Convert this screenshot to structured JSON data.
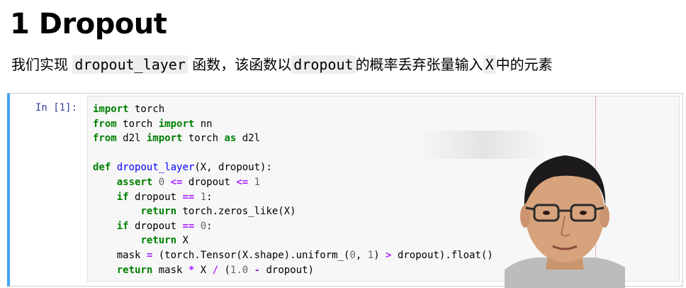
{
  "heading": {
    "number": "1",
    "text": "Dropout"
  },
  "description": {
    "part1": "我们实现 ",
    "func_name": "dropout_layer",
    "part2": " 函数，该函数以",
    "dropout_word": "dropout",
    "part3": "的概率丢弃张量输入",
    "x_var": "X",
    "part4": "中的元素"
  },
  "cell": {
    "prompt": "In [1]:",
    "code_lines": [
      "import torch",
      "from torch import nn",
      "from d2l import torch as d2l",
      "",
      "def dropout_layer(X, dropout):",
      "    assert 0 <= dropout <= 1",
      "    if dropout == 1:",
      "        return torch.zeros_like(X)",
      "    if dropout == 0:",
      "        return X",
      "    mask = (torch.Tensor(X.shape).uniform_(0, 1) > dropout).float()",
      "    return mask * X / (1.0 - dropout)"
    ]
  },
  "colors": {
    "keyword": "#008000",
    "operator": "#aa22ff",
    "number": "#666666",
    "function_def": "#0000ff",
    "prompt": "#303f9f",
    "cell_border_active": "#42a5f5"
  },
  "overlay": {
    "type": "webcam-presenter"
  }
}
